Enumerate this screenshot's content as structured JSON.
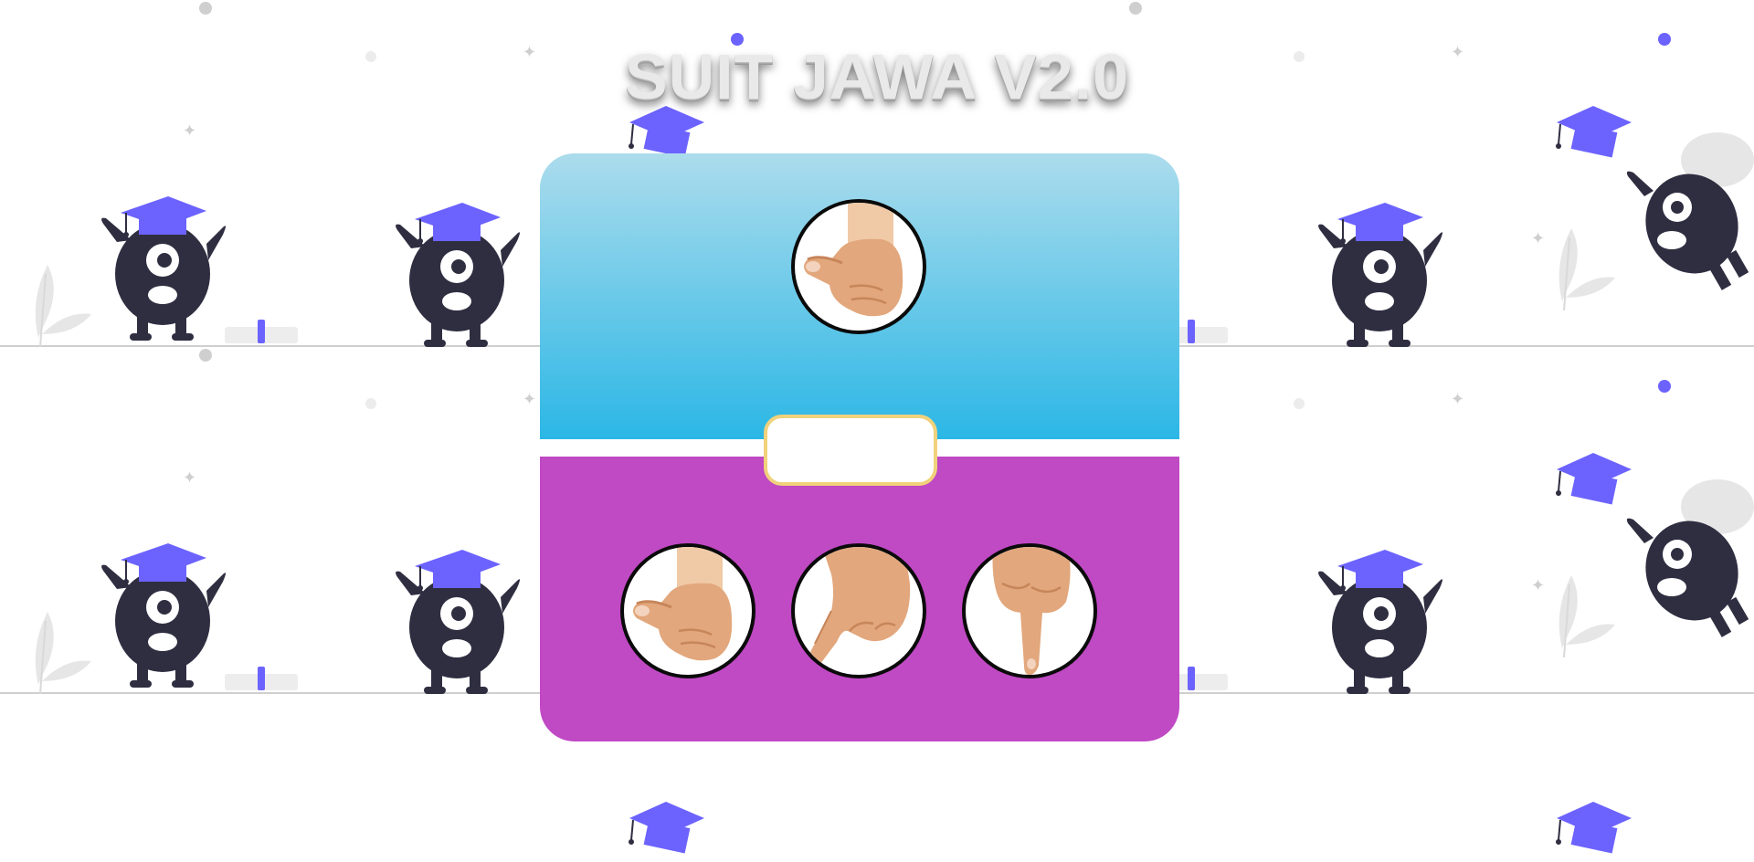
{
  "game": {
    "title": "SUIT JAWA V2.0",
    "result_text": ""
  },
  "opponent": {
    "choice": "gajah",
    "choice_icon": "thumb-fist-icon"
  },
  "player": {
    "choices": [
      {
        "id": "gajah",
        "icon": "thumb-fist-icon"
      },
      {
        "id": "orang",
        "icon": "index-finger-point-icon"
      },
      {
        "id": "semut",
        "icon": "pinky-finger-point-icon"
      }
    ]
  },
  "colors": {
    "opponent_panel_top": "#acdcec",
    "opponent_panel_bottom": "#2bb7e6",
    "player_panel": "#c049c4",
    "result_border": "#f1d27c",
    "accent_purple": "#6c63ff",
    "creature_dark": "#2f2e41"
  }
}
